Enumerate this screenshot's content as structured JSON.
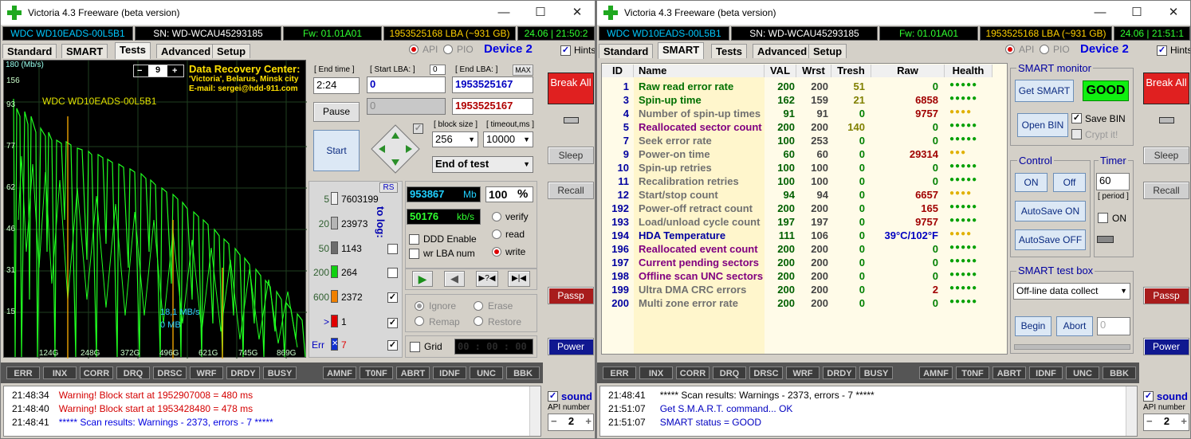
{
  "left": {
    "title": "Victoria 4.3 Freeware (beta version)",
    "info": {
      "model": "WDC WD10EADS-00L5B1",
      "serial": "SN: WD-WCAU45293185",
      "fw": "Fw: 01.01A01",
      "lba": "1953525168 LBA (~931 GB)",
      "clock": "24.06 | 21:50:2"
    },
    "tabs": [
      "Standard",
      "SMART",
      "Tests",
      "Advanced",
      "Setup"
    ],
    "api": "API",
    "pio": "PIO",
    "device": "Device 2",
    "hints": "Hints",
    "graph": {
      "ylabel": "180 (Mb/s)",
      "yticks": [
        "156",
        "93",
        "77",
        "62",
        "46",
        "31",
        "15"
      ],
      "xticks": [
        "124G",
        "248G",
        "372G",
        "496G",
        "621G",
        "745G",
        "869G"
      ],
      "model": "WDC WD10EADS-00L5B1",
      "speed": "18,1 MB/s",
      "mb": "0 MB",
      "counter": "9"
    },
    "recovery": {
      "title": "Data Recovery Center:",
      "line2": "'Victoria', Belarus, Minsk city",
      "line3": "E-mail: sergei@hdd-911.com"
    },
    "end_time_label": "[ End time ]",
    "end_time": "2:24",
    "start_lba_label": "[ Start LBA: ]",
    "start_lba_value": "0",
    "start_lba": "0",
    "end_lba_label": "[ End LBA: ]",
    "max": "MAX",
    "end_lba": "1953525167",
    "start_lba2": "0",
    "end_lba2": "1953525167",
    "pause": "Pause",
    "start": "Start",
    "block_size_label": "[ block size ]",
    "block_size": "256",
    "timeout_label": "[ timeout,ms ]",
    "timeout": "10000",
    "end_of_test": "End of test",
    "rs": "RS",
    "counts": [
      {
        "ms": "5",
        "n": "7603199"
      },
      {
        "ms": "20",
        "n": "23973"
      },
      {
        "ms": "50",
        "n": "1143"
      },
      {
        "ms": "200",
        "n": "264"
      },
      {
        "ms": "600",
        "n": "2372"
      },
      {
        "ms": ">",
        "n": "1"
      },
      {
        "ms": "Err",
        "n": "7"
      }
    ],
    "to_log": "to log:",
    "mb_value": "953867",
    "mb_unit": "Mb",
    "percent": "100",
    "pct_unit": "%",
    "kbs_value": "50176",
    "kbs_unit": "kb/s",
    "verify": "verify",
    "read": "read",
    "write": "write",
    "ddd": "DDD Enable",
    "wrlba": "wr LBA num",
    "ignore": "Ignore",
    "erase": "Erase",
    "remap": "Remap",
    "restore": "Restore",
    "grid": "Grid",
    "timer": "00 : 00 : 00",
    "break": "Break All",
    "sleep": "Sleep",
    "recall": "Recall",
    "passp": "Passp",
    "power": "Power",
    "flags": [
      "ERR",
      "INX",
      "CORR",
      "DRQ",
      "DRSC",
      "WRF",
      "DRDY",
      "BUSY",
      "AMNF",
      "T0NF",
      "ABRT",
      "IDNF",
      "UNC",
      "BBK"
    ],
    "log": [
      {
        "t": "21:48:34",
        "m": "Warning! Block start at 1952907008 = 480 ms",
        "c": "#d40000"
      },
      {
        "t": "21:48:40",
        "m": "Warning! Block start at 1953428480 = 478 ms",
        "c": "#d40000"
      },
      {
        "t": "21:48:41",
        "m": "***** Scan results: Warnings - 2373, errors - 7 *****",
        "c": "#0000e0"
      }
    ],
    "sound": "sound",
    "api_number_label": "API number",
    "api_number": "2"
  },
  "right": {
    "title": "Victoria 4.3 Freeware (beta version)",
    "info": {
      "model": "WDC WD10EADS-00L5B1",
      "serial": "SN: WD-WCAU45293185",
      "fw": "Fw: 01.01A01",
      "lba": "1953525168 LBA (~931 GB)",
      "clock": "24.06 | 21:51:1"
    },
    "tabs": [
      "Standard",
      "SMART",
      "Tests",
      "Advanced",
      "Setup"
    ],
    "api": "API",
    "pio": "PIO",
    "device": "Device 2",
    "hints": "Hints",
    "cols": [
      "ID",
      "Name",
      "VAL",
      "Wrst",
      "Tresh",
      "Raw",
      "Health"
    ],
    "rows": [
      {
        "id": "1",
        "name": "Raw read error rate",
        "val": "200",
        "wrst": "200",
        "tresh": "51",
        "raw": "0",
        "h": "●●●●●",
        "nc": "#007000",
        "hc": "#00a000"
      },
      {
        "id": "3",
        "name": "Spin-up time",
        "val": "162",
        "wrst": "159",
        "tresh": "21",
        "raw": "6858",
        "h": "●●●●●",
        "nc": "#007000",
        "hc": "#00a000"
      },
      {
        "id": "4",
        "name": "Number of spin-up times",
        "val": "91",
        "wrst": "91",
        "tresh": "0",
        "raw": "9757",
        "h": "●●●●",
        "nc": "#707070",
        "hc": "#e0b000"
      },
      {
        "id": "5",
        "name": "Reallocated sector count",
        "val": "200",
        "wrst": "200",
        "tresh": "140",
        "raw": "0",
        "h": "●●●●●",
        "nc": "#800080",
        "hc": "#00a000"
      },
      {
        "id": "7",
        "name": "Seek error rate",
        "val": "100",
        "wrst": "253",
        "tresh": "0",
        "raw": "0",
        "h": "●●●●●",
        "nc": "#707070",
        "hc": "#00a000"
      },
      {
        "id": "9",
        "name": "Power-on time",
        "val": "60",
        "wrst": "60",
        "tresh": "0",
        "raw": "29314",
        "h": "●●●",
        "nc": "#707070",
        "hc": "#e0b000"
      },
      {
        "id": "10",
        "name": "Spin-up retries",
        "val": "100",
        "wrst": "100",
        "tresh": "0",
        "raw": "0",
        "h": "●●●●●",
        "nc": "#707070",
        "hc": "#00a000"
      },
      {
        "id": "11",
        "name": "Recalibration retries",
        "val": "100",
        "wrst": "100",
        "tresh": "0",
        "raw": "0",
        "h": "●●●●●",
        "nc": "#707070",
        "hc": "#00a000"
      },
      {
        "id": "12",
        "name": "Start/stop count",
        "val": "94",
        "wrst": "94",
        "tresh": "0",
        "raw": "6657",
        "h": "●●●●",
        "nc": "#707070",
        "hc": "#e0b000"
      },
      {
        "id": "192",
        "name": "Power-off retract count",
        "val": "200",
        "wrst": "200",
        "tresh": "0",
        "raw": "165",
        "h": "●●●●●",
        "nc": "#707070",
        "hc": "#00a000"
      },
      {
        "id": "193",
        "name": "Load/unload cycle count",
        "val": "197",
        "wrst": "197",
        "tresh": "0",
        "raw": "9757",
        "h": "●●●●●",
        "nc": "#707070",
        "hc": "#00a000"
      },
      {
        "id": "194",
        "name": "HDA Temperature",
        "val": "111",
        "wrst": "106",
        "tresh": "0",
        "raw": "39°C/102°F",
        "h": "●●●●",
        "nc": "#0000a0",
        "hc": "#e0b000"
      },
      {
        "id": "196",
        "name": "Reallocated event count",
        "val": "200",
        "wrst": "200",
        "tresh": "0",
        "raw": "0",
        "h": "●●●●●",
        "nc": "#800080",
        "hc": "#00a000"
      },
      {
        "id": "197",
        "name": "Current pending sectors",
        "val": "200",
        "wrst": "200",
        "tresh": "0",
        "raw": "0",
        "h": "●●●●●",
        "nc": "#800080",
        "hc": "#00a000"
      },
      {
        "id": "198",
        "name": "Offline scan UNC sectors",
        "val": "200",
        "wrst": "200",
        "tresh": "0",
        "raw": "0",
        "h": "●●●●●",
        "nc": "#800080",
        "hc": "#00a000"
      },
      {
        "id": "199",
        "name": "Ultra DMA CRC errors",
        "val": "200",
        "wrst": "200",
        "tresh": "0",
        "raw": "2",
        "h": "●●●●●",
        "nc": "#707070",
        "hc": "#00a000"
      },
      {
        "id": "200",
        "name": "Multi zone error rate",
        "val": "200",
        "wrst": "200",
        "tresh": "0",
        "raw": "0",
        "h": "●●●●●",
        "nc": "#707070",
        "hc": "#00a000"
      }
    ],
    "smart_monitor": "SMART monitor",
    "get_smart": "Get SMART",
    "good": "GOOD",
    "open_bin": "Open BIN",
    "save_bin": "Save BIN",
    "crypt": "Crypt it!",
    "control": "Control",
    "on": "ON",
    "off": "Off",
    "autosave_on": "AutoSave ON",
    "autosave_off": "AutoSave OFF",
    "timer": "Timer",
    "timer_value": "60",
    "period": "[ period ]",
    "timer_on": "ON",
    "test_box": "SMART test box",
    "test_select": "Off-line data collect",
    "begin": "Begin",
    "abort": "Abort",
    "test_value": "0",
    "break": "Break All",
    "sleep": "Sleep",
    "recall": "Recall",
    "passp": "Passp",
    "power": "Power",
    "flags": [
      "ERR",
      "INX",
      "CORR",
      "DRQ",
      "DRSC",
      "WRF",
      "DRDY",
      "BUSY",
      "AMNF",
      "T0NF",
      "ABRT",
      "IDNF",
      "UNC",
      "BBK"
    ],
    "log": [
      {
        "t": "21:48:41",
        "m": "***** Scan results: Warnings - 2373, errors - 7 *****",
        "c": "#000000"
      },
      {
        "t": "21:51:07",
        "m": "Get S.M.A.R.T. command... OK",
        "c": "#0000c0"
      },
      {
        "t": "21:51:07",
        "m": "SMART status = GOOD",
        "c": "#0000c0"
      }
    ],
    "sound": "sound",
    "api_number_label": "API number",
    "api_number": "2"
  }
}
